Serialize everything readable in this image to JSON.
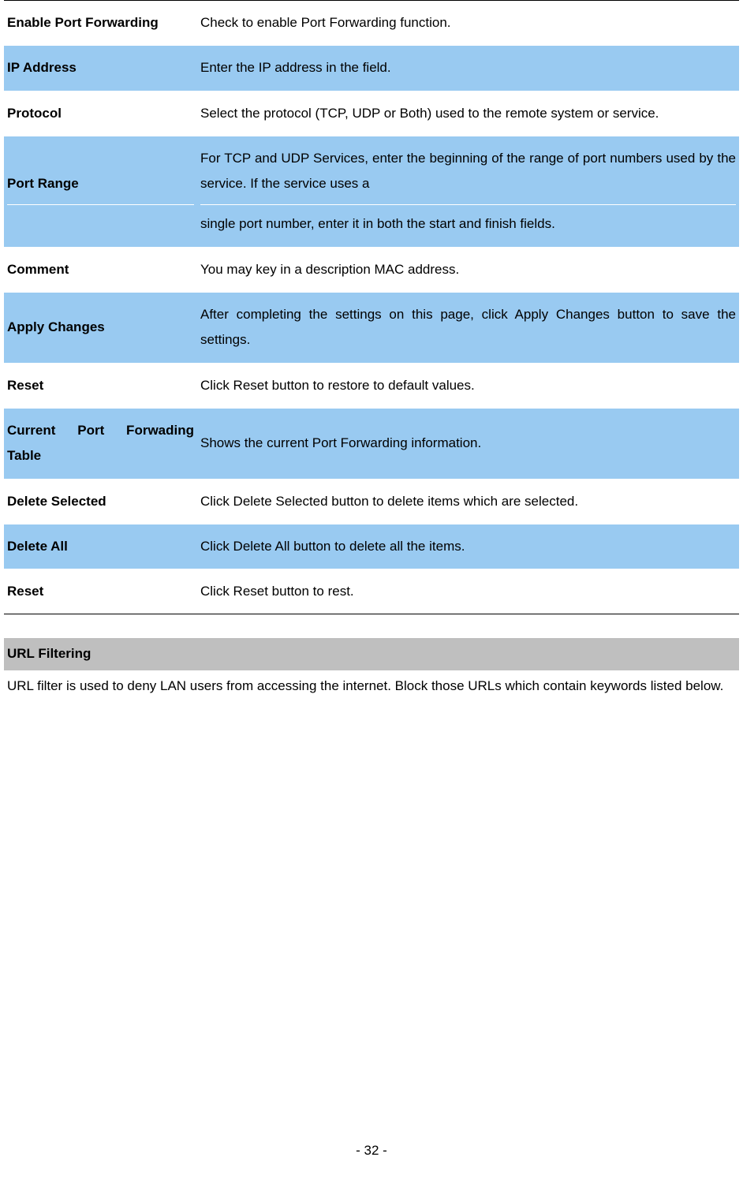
{
  "table": {
    "rows": [
      {
        "label": "Enable Port Forwarding",
        "value": "Check to enable Port Forwarding function.",
        "highlight": false
      },
      {
        "label": "IP Address",
        "value": "Enter the IP address in the field.",
        "highlight": true
      },
      {
        "label": "Protocol",
        "value": "Select the protocol (TCP, UDP or Both) used to the remote system or service.",
        "highlight": false
      },
      {
        "label": "Port Range",
        "value_part1": "For TCP and UDP Services, enter the beginning of the range of port numbers used by the service. If the service uses a",
        "value_part2": "single port number, enter it in both the start and finish fields.",
        "highlight": true
      },
      {
        "label": "Comment",
        "value": "You may key in a description MAC address.",
        "highlight": false
      },
      {
        "label": "Apply Changes",
        "value": "After completing the settings on this page, click Apply Changes button to save the settings.",
        "highlight": true
      },
      {
        "label": "Reset",
        "value": "Click Reset button to restore to default values.",
        "highlight": false
      },
      {
        "label": "Current Port Forwading Table",
        "value": "Shows the current Port Forwarding information.",
        "highlight": true,
        "justifyLabel": true
      },
      {
        "label": "Delete Selected",
        "value": "Click Delete Selected button to delete items which are selected.",
        "highlight": false
      },
      {
        "label": "Delete All",
        "value": "Click Delete All button to delete all the items.",
        "highlight": true
      },
      {
        "label": "Reset",
        "value": "Click Reset button to rest.",
        "highlight": false
      }
    ]
  },
  "section": {
    "header": "URL Filtering",
    "body": "URL filter is used to deny LAN users from accessing the internet. Block those URLs which contain keywords listed below."
  },
  "pageNumber": "- 32 -"
}
